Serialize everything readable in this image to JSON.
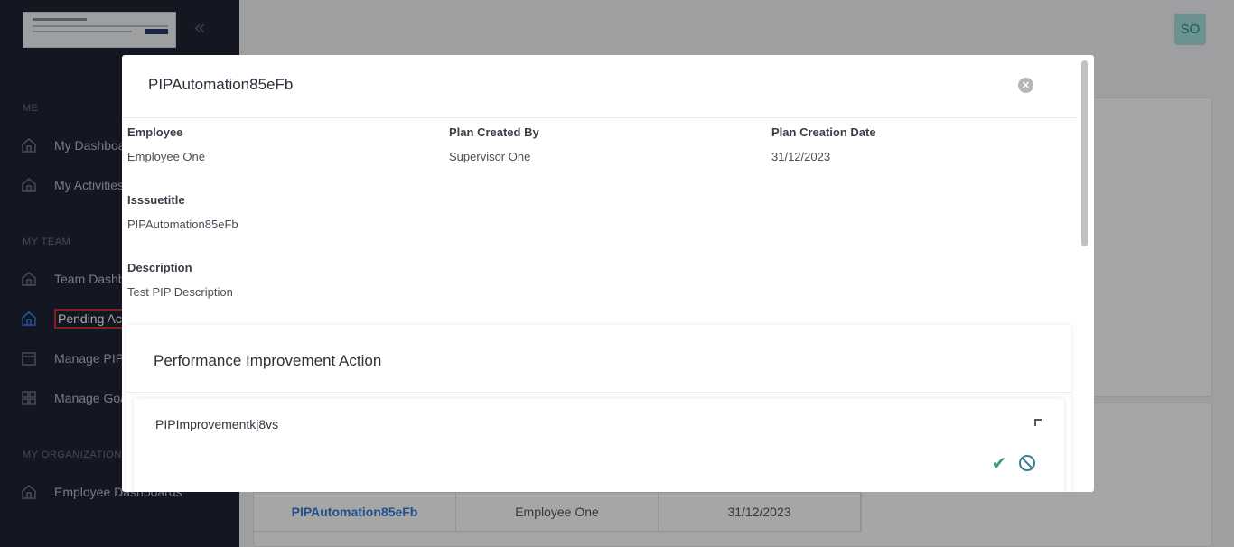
{
  "sidebar": {
    "sections": {
      "me": "ME",
      "my_team": "MY TEAM",
      "my_org": "MY ORGANIZATION"
    },
    "items": {
      "my_dashboard": "My Dashboard",
      "my_activities": "My Activities",
      "team_dashboard": "Team Dashboard",
      "pending_actions": "Pending Actions",
      "manage_pip": "Manage PIP",
      "manage_goals": "Manage Goals",
      "employee_dashboards": "Employee Dashboards"
    }
  },
  "header": {
    "avatar_initials": "SO"
  },
  "background_table": {
    "row": [
      "PIPAutomation85eFb",
      "Employee One",
      "31/12/2023"
    ]
  },
  "modal": {
    "title": "PIPAutomation85eFb",
    "fields": {
      "employee": {
        "label": "Employee",
        "value": "Employee One"
      },
      "plan_created_by": {
        "label": "Plan Created By",
        "value": "Supervisor One"
      },
      "plan_creation_date": {
        "label": "Plan Creation Date",
        "value": "31/12/2023"
      },
      "issue_title": {
        "label": "Isssuetitle",
        "value": "PIPAutomation85eFb"
      },
      "description": {
        "label": "Description",
        "value": "Test PIP Description"
      }
    },
    "pia": {
      "title": "Performance Improvement Action",
      "item_title": "PIPImprovementkj8vs"
    }
  },
  "colors": {
    "sidebar_bg": "#1f2333",
    "accent": "#3a9a8f",
    "link": "#2f7bd6",
    "active_outline": "#d0312d"
  }
}
